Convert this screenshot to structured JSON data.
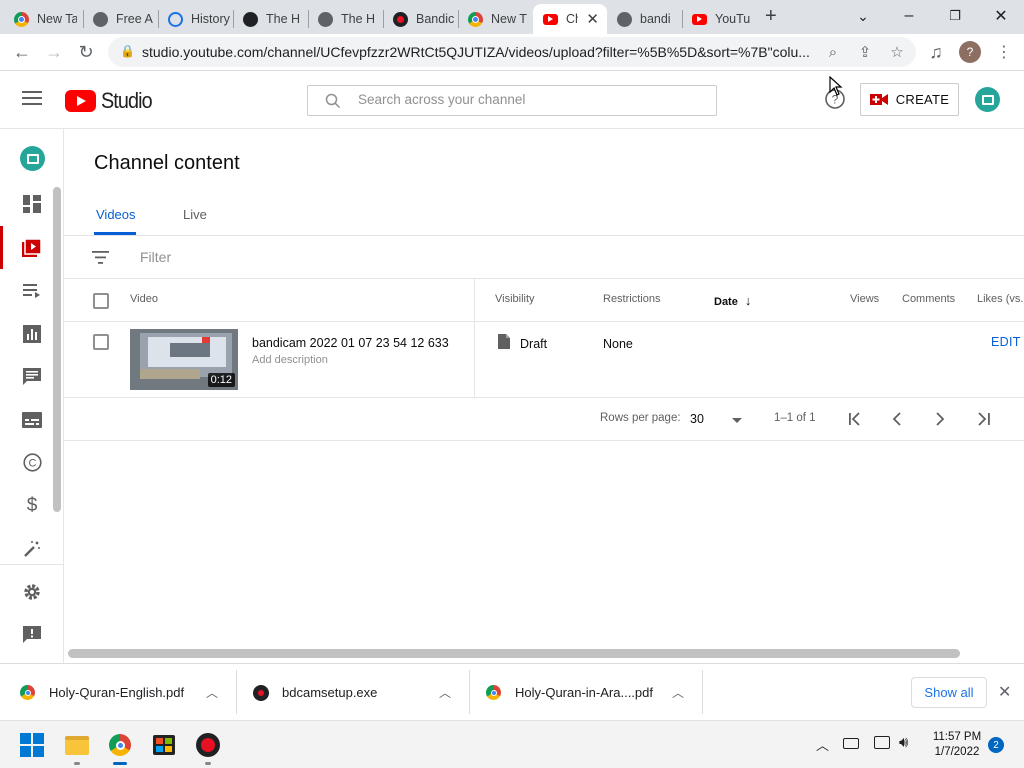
{
  "browser": {
    "tabs": [
      {
        "title": "New Ta",
        "favicon": "chrome-icon"
      },
      {
        "title": "Free A",
        "favicon": "globe-icon"
      },
      {
        "title": "History",
        "favicon": "history-icon"
      },
      {
        "title": "The H",
        "favicon": "person-icon"
      },
      {
        "title": "The H",
        "favicon": "globe-icon"
      },
      {
        "title": "Bandic",
        "favicon": "record-icon"
      },
      {
        "title": "New T",
        "favicon": "chrome-icon"
      },
      {
        "title": "Ch",
        "favicon": "youtube-icon",
        "active": true
      },
      {
        "title": "bandi",
        "favicon": "globe-icon"
      },
      {
        "title": "YouTu",
        "favicon": "youtube-icon"
      }
    ],
    "url": "studio.youtube.com/channel/UCfevpfzzr2WRtCt5QJUTIZA/videos/upload?filter=%5B%5D&sort=%7B\"colu...",
    "profile_initial": "?"
  },
  "studio": {
    "logo_text": "Studio",
    "search_placeholder": "Search across your channel",
    "create_label": "CREATE"
  },
  "main": {
    "title": "Channel content",
    "tabs": [
      "Videos",
      "Live"
    ],
    "filter_placeholder": "Filter",
    "columns": {
      "video": "Video",
      "visibility": "Visibility",
      "restrictions": "Restrictions",
      "date": "Date",
      "views": "Views",
      "comments": "Comments",
      "likes": "Likes (vs."
    },
    "rows": [
      {
        "title": "bandicam 2022 01 07 23 54 12 633",
        "description": "Add description",
        "duration": "0:12",
        "visibility": "Draft",
        "restrictions": "None",
        "action": "EDIT D"
      }
    ],
    "pagination": {
      "rows_label": "Rows per page:",
      "rows_value": "30",
      "range": "1–1 of 1"
    }
  },
  "downloads": [
    {
      "name": "Holy-Quran-English.pdf"
    },
    {
      "name": "bdcamsetup.exe"
    },
    {
      "name": "Holy-Quran-in-Ara....pdf"
    }
  ],
  "downloads_show_all": "Show all",
  "taskbar": {
    "time": "11:57 PM",
    "date": "1/7/2022",
    "notifications": "2"
  },
  "colors": {
    "youtube_red": "#ff0000",
    "accent_blue": "#065fd4",
    "active_red": "#cc0000"
  }
}
